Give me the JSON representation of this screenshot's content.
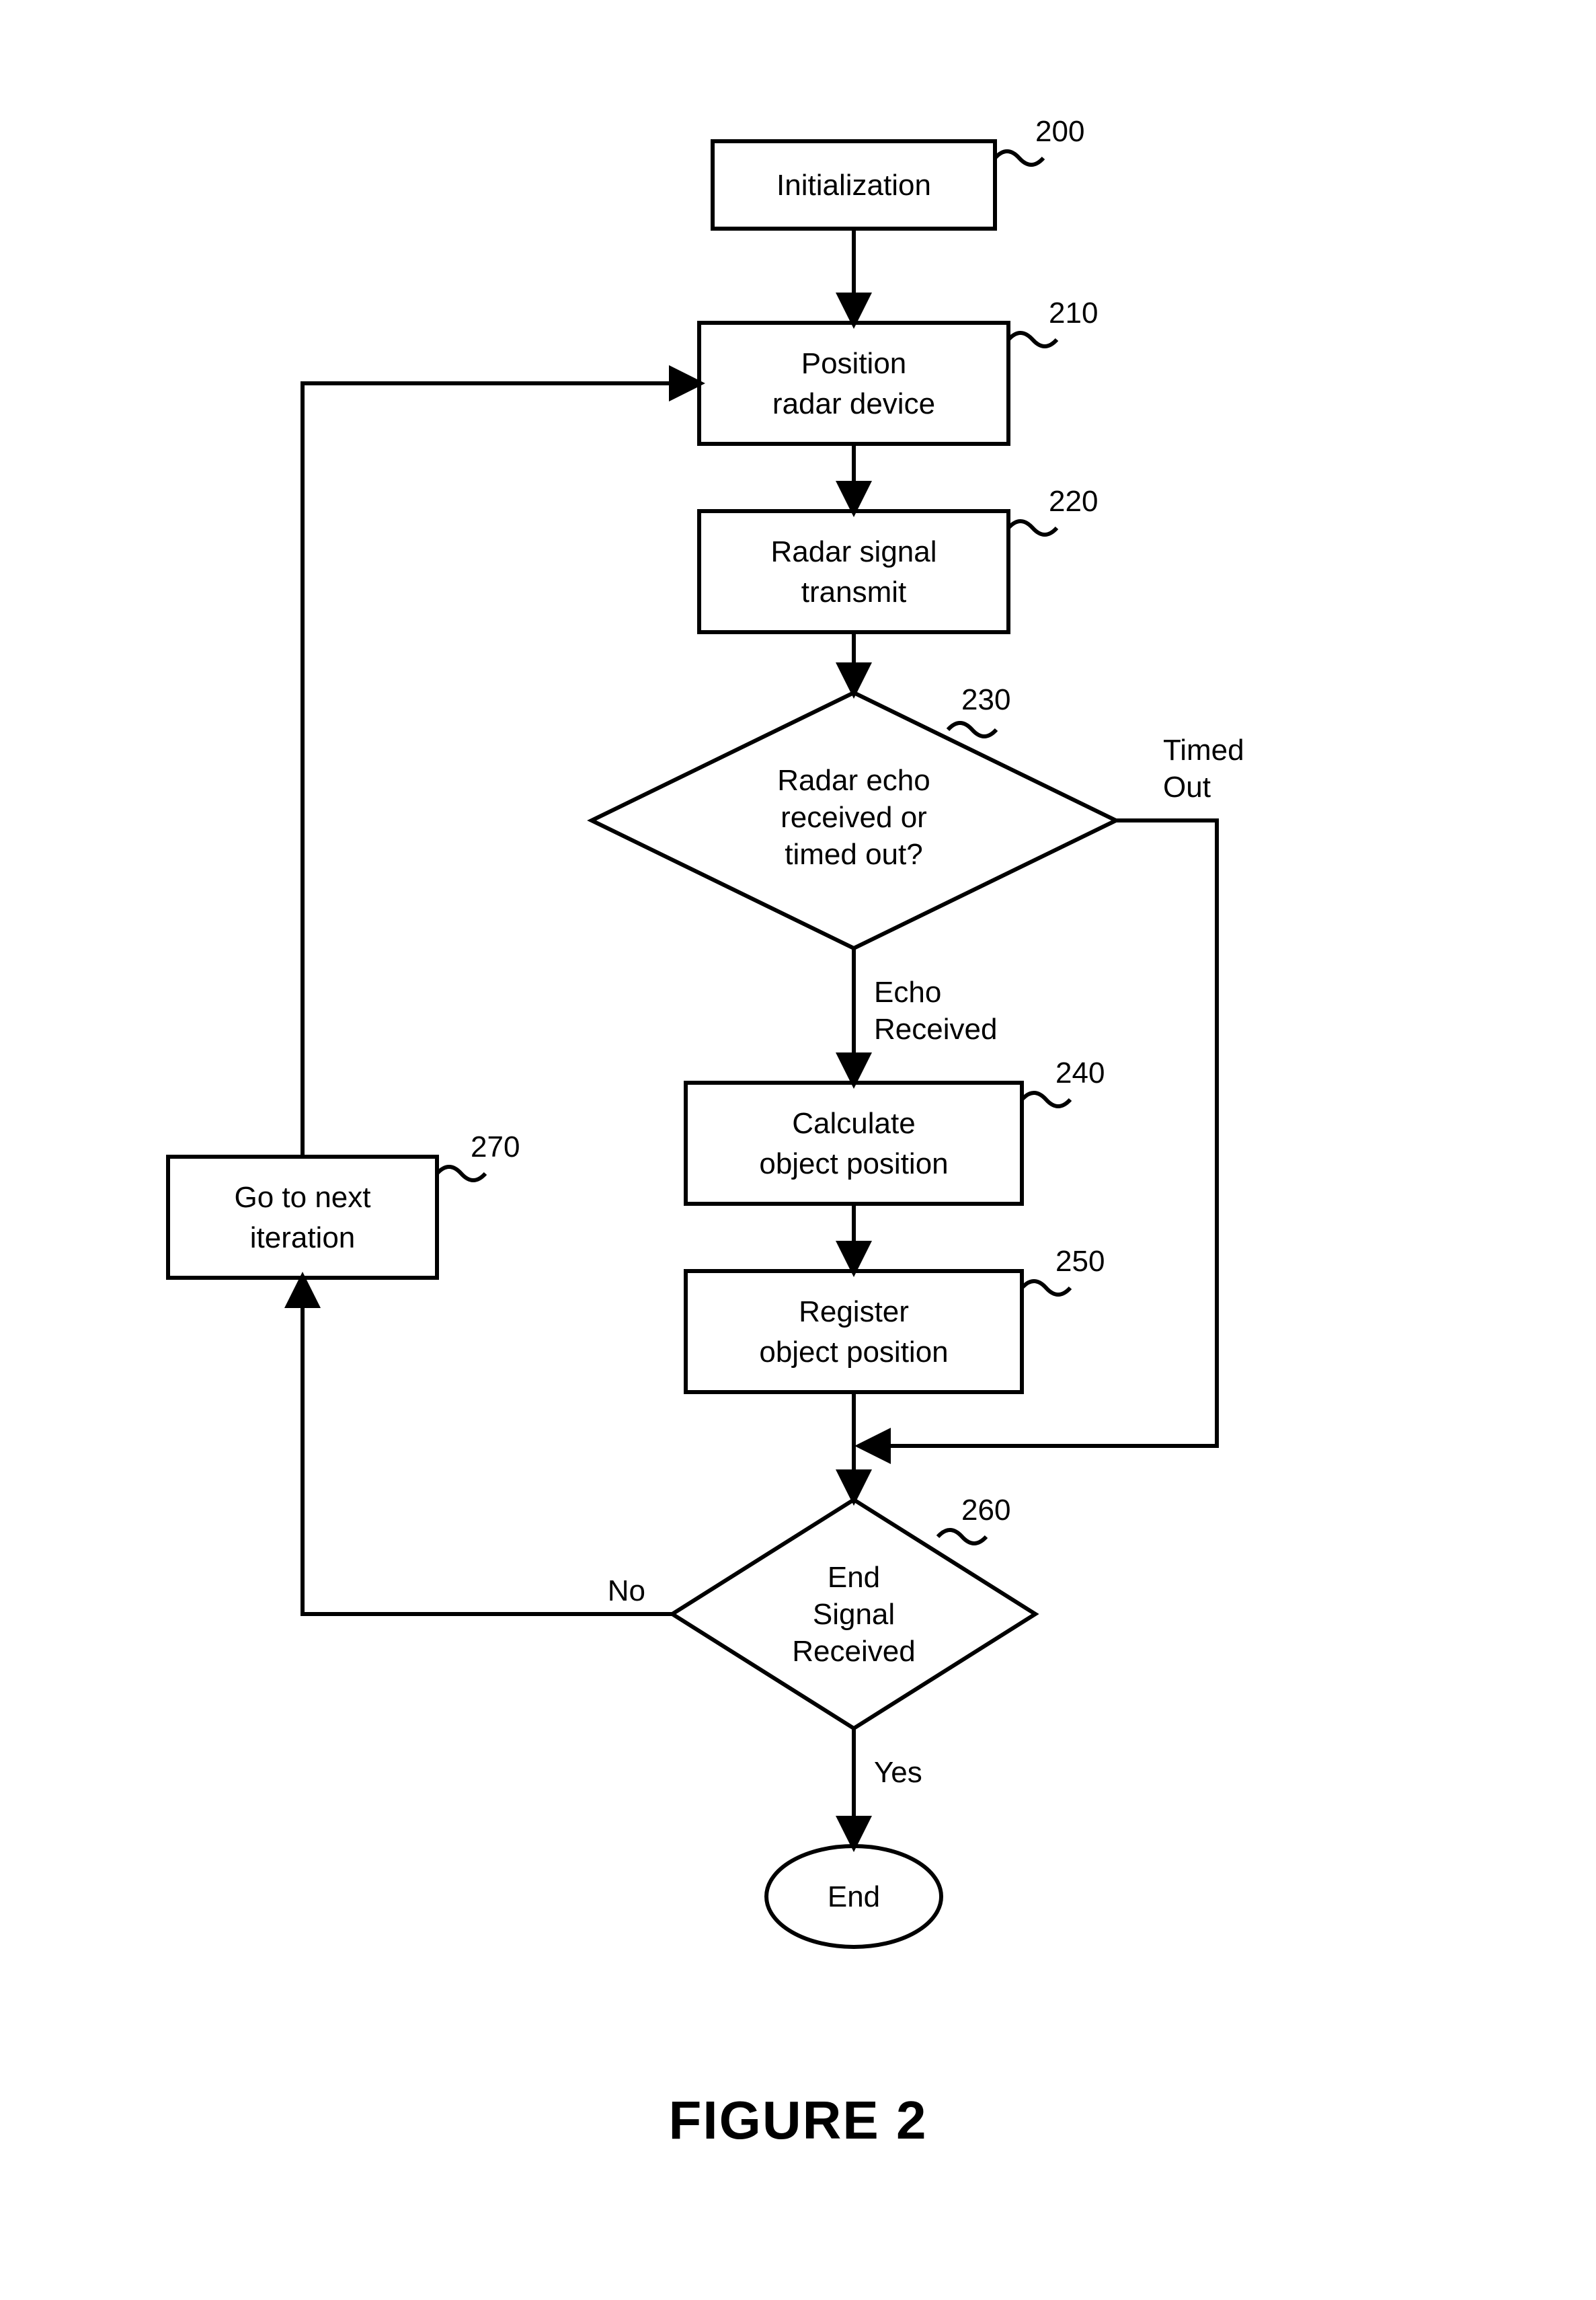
{
  "title": "FIGURE 2",
  "nodes": {
    "init": {
      "ref": "200",
      "lines": [
        "Initialization"
      ]
    },
    "pos": {
      "ref": "210",
      "lines": [
        "Position",
        "radar device"
      ]
    },
    "tx": {
      "ref": "220",
      "lines": [
        "Radar signal",
        "transmit"
      ]
    },
    "echo": {
      "ref": "230",
      "lines": [
        "Radar echo",
        "received or",
        "timed out?"
      ]
    },
    "calc": {
      "ref": "240",
      "lines": [
        "Calculate",
        "object position"
      ]
    },
    "reg": {
      "ref": "250",
      "lines": [
        "Register",
        "object position"
      ]
    },
    "endq": {
      "ref": "260",
      "lines": [
        "End",
        "Signal",
        "Received"
      ]
    },
    "next": {
      "ref": "270",
      "lines": [
        "Go to next",
        "iteration"
      ]
    },
    "end": {
      "lines": [
        "End"
      ]
    }
  },
  "edgeLabels": {
    "timedOut": [
      "Timed",
      "Out"
    ],
    "echoReceived": [
      "Echo",
      "Received"
    ],
    "no": "No",
    "yes": "Yes"
  }
}
